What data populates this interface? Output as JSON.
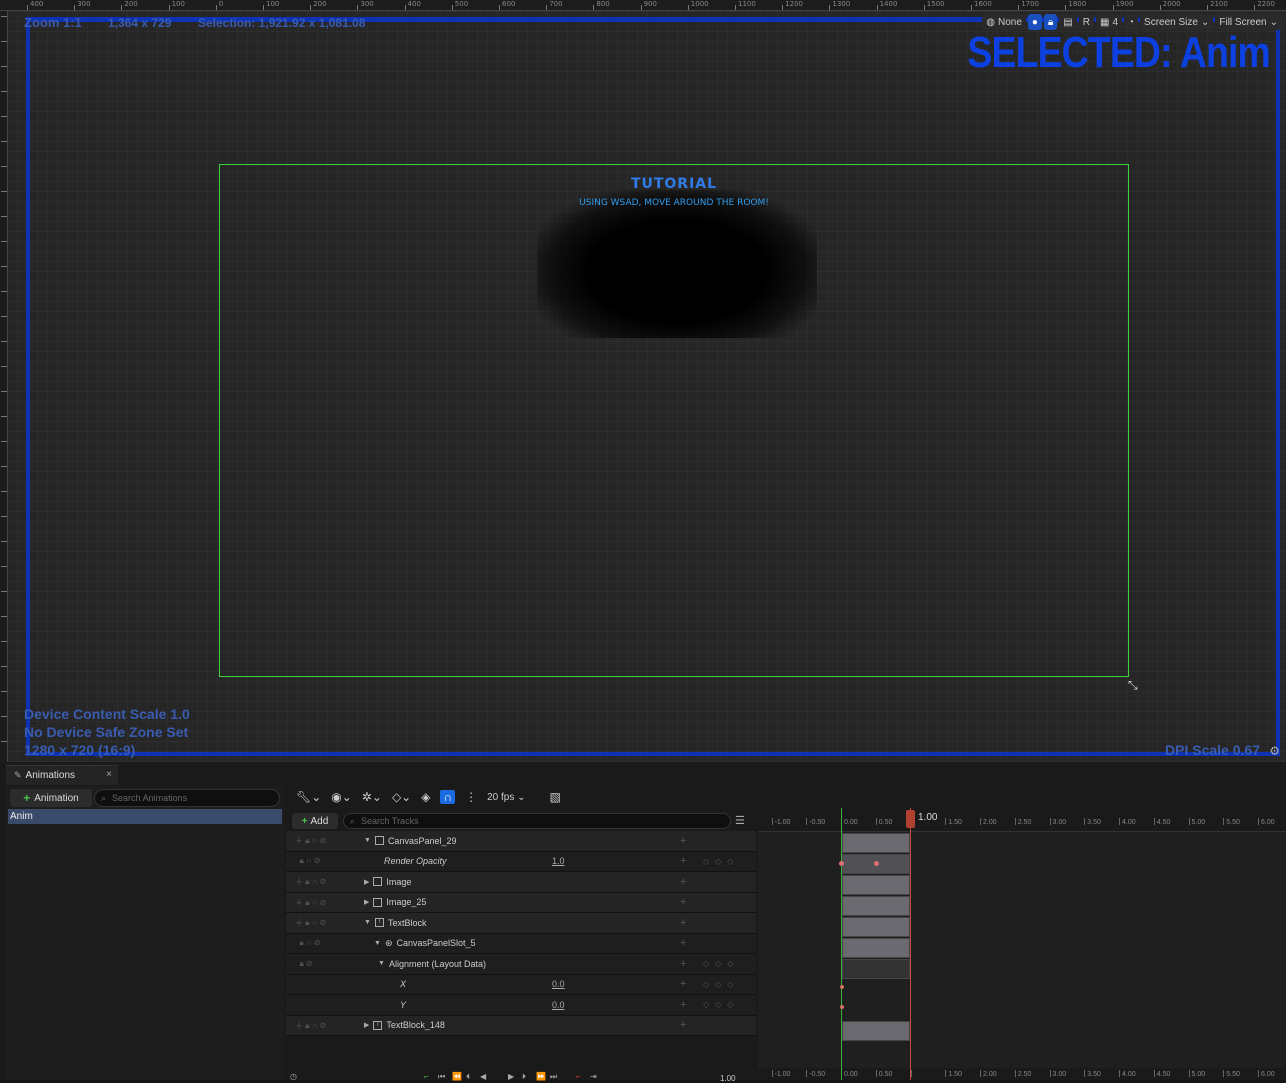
{
  "designer": {
    "zoom": "Zoom 1:1",
    "dims": "1,364 x 729",
    "selection": "Selection: 1,921.92 x 1,081.08",
    "selected_label": "SELECTED: Anim",
    "device_scale": "Device Content Scale 1.0",
    "safe_zone": "No Device Safe Zone Set",
    "resolution": "1280 x 720 (16:9)",
    "dpi": "DPI Scale 0.67",
    "toolbar": {
      "none_label": "None",
      "r_label": "R",
      "grid_value": "4",
      "screen_size": "Screen Size",
      "fill_screen": "Fill Screen"
    },
    "ruler_top": [
      "400",
      "300",
      "200",
      "100",
      "0",
      "100",
      "200",
      "300",
      "400",
      "500",
      "600",
      "700",
      "800",
      "900",
      "1000",
      "1100",
      "1200",
      "1300",
      "1400",
      "1500",
      "1600",
      "1700",
      "1800",
      "1900",
      "2000",
      "2100",
      "2200"
    ],
    "canvas": {
      "title": "TUTORIAL",
      "subtitle": "USING WSAD, MOVE AROUND THE ROOM!"
    }
  },
  "animations_panel": {
    "tab_label": "Animations",
    "add_button": "Animation",
    "search_placeholder": "Search Animations",
    "items": [
      "Anim"
    ]
  },
  "sequencer": {
    "fps": "20 fps",
    "add_button": "Add",
    "search_placeholder": "Search Tracks",
    "playhead_value": "1.00",
    "bottom_value": "1.00",
    "tracks": [
      {
        "name": "CanvasPanel_29",
        "value": ""
      },
      {
        "name": "Render Opacity",
        "value": "1.0"
      },
      {
        "name": "Image",
        "value": ""
      },
      {
        "name": "Image_25",
        "value": ""
      },
      {
        "name": "TextBlock",
        "value": ""
      },
      {
        "name": "CanvasPanelSlot_5",
        "value": ""
      },
      {
        "name": "Alignment (Layout Data)",
        "value": ""
      },
      {
        "name": "X",
        "value": "0.0"
      },
      {
        "name": "Y",
        "value": "0.0"
      },
      {
        "name": "TextBlock_148",
        "value": ""
      }
    ],
    "timeline_ticks": [
      "-1.00",
      "-0.50",
      "0.00",
      "0.50",
      "1.00",
      "1.50",
      "2.00",
      "2.50",
      "3.00",
      "3.50",
      "4.00",
      "4.50",
      "5.00",
      "5.50",
      "6.00"
    ]
  }
}
